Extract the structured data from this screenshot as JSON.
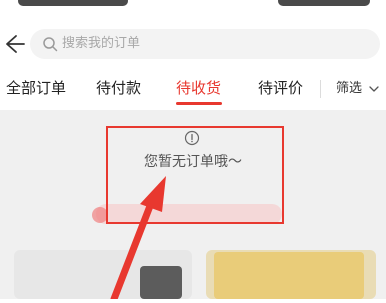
{
  "search": {
    "placeholder": "搜索我的订单"
  },
  "tabs": [
    {
      "label": "全部订单"
    },
    {
      "label": "待付款"
    },
    {
      "label": "待收货"
    },
    {
      "label": "待评价"
    }
  ],
  "active_tab": "待收货",
  "filter": {
    "label": "筛选"
  },
  "empty": {
    "message": "您暂无订单哦～"
  },
  "colors": {
    "accent": "#e8382f",
    "annotation": "#e8382f"
  },
  "icons": {
    "back": "back-arrow-icon",
    "search": "search-icon",
    "filter": "chevron-down-icon",
    "empty": "info-icon",
    "annotation": "red-arrow-annotation-icon"
  }
}
